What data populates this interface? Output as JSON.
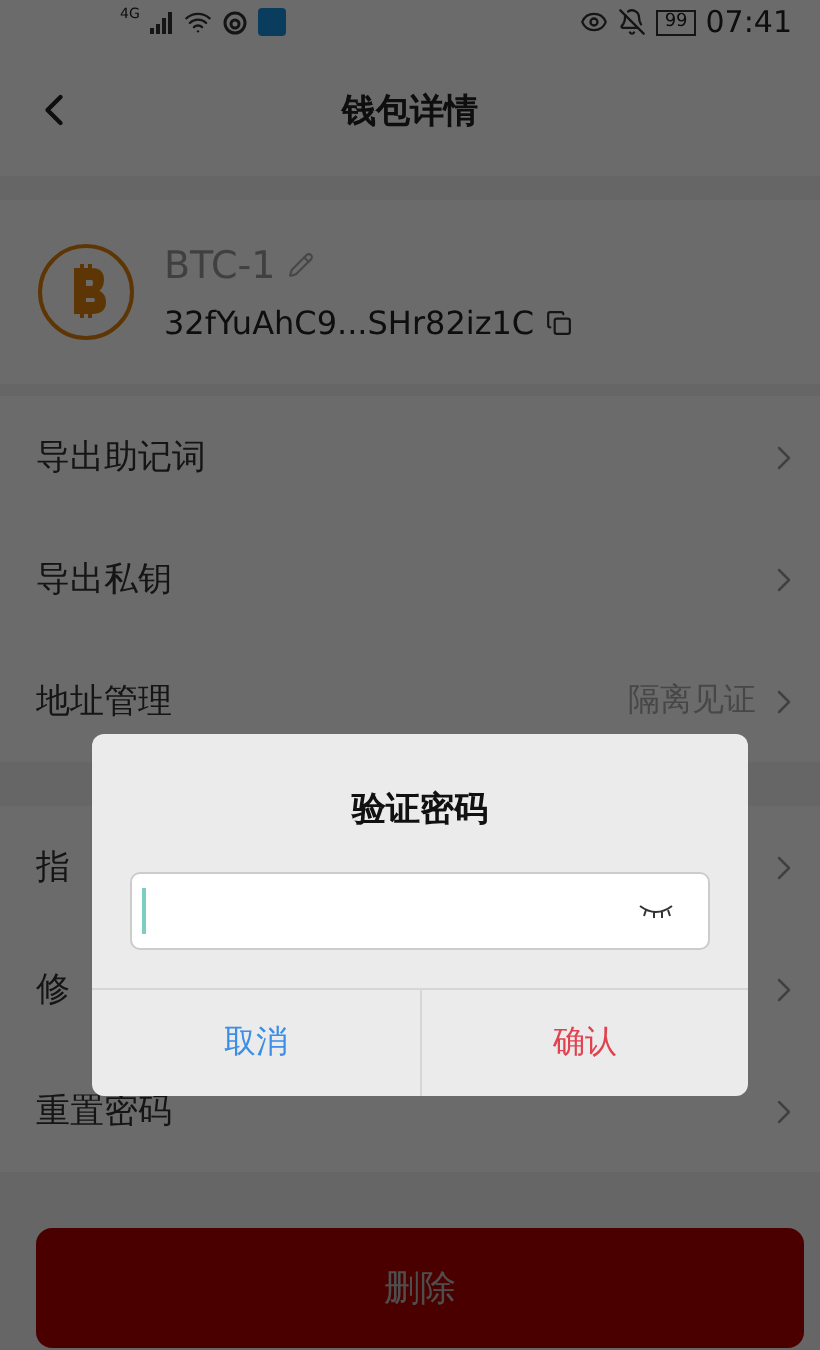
{
  "status_bar": {
    "network": "4G",
    "battery": "99",
    "time": "07:41"
  },
  "header": {
    "title": "钱包详情"
  },
  "wallet": {
    "name": "BTC-1",
    "address": "32fYuAhC9...SHr82iz1C"
  },
  "menu_groups": [
    {
      "items": [
        {
          "label": "导出助记词"
        },
        {
          "label": "导出私钥"
        },
        {
          "label": "地址管理",
          "value": "隔离见证"
        }
      ]
    },
    {
      "items": [
        {
          "label": "指"
        },
        {
          "label": "修"
        },
        {
          "label": "重置密码"
        }
      ]
    }
  ],
  "delete_button": "删除",
  "dialog": {
    "title": "验证密码",
    "show_password": false,
    "buttons": [
      {
        "label": "取消",
        "kind": "cancel"
      },
      {
        "label": "确认",
        "kind": "confirm"
      }
    ]
  }
}
